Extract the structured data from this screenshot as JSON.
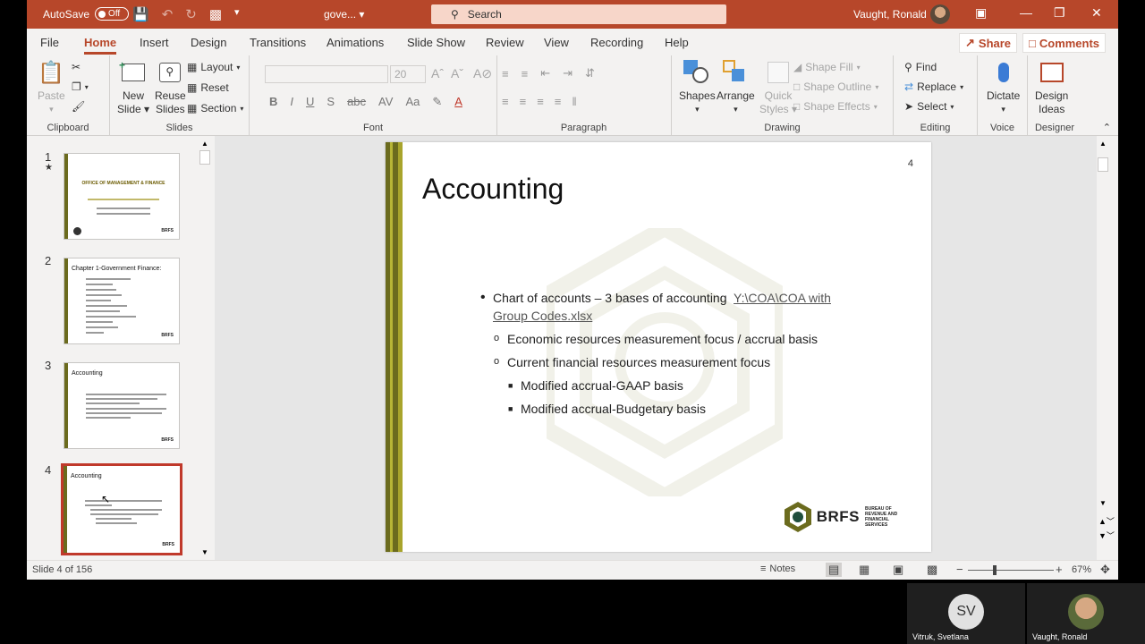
{
  "titlebar": {
    "autosave_label": "AutoSave",
    "autosave_state": "Off",
    "filename": "gove...",
    "search_placeholder": "Search",
    "user_name": "Vaught, Ronald"
  },
  "tabs": [
    {
      "label": "File"
    },
    {
      "label": "Home",
      "active": true
    },
    {
      "label": "Insert"
    },
    {
      "label": "Design"
    },
    {
      "label": "Transitions"
    },
    {
      "label": "Animations"
    },
    {
      "label": "Slide Show"
    },
    {
      "label": "Review"
    },
    {
      "label": "View"
    },
    {
      "label": "Recording"
    },
    {
      "label": "Help"
    }
  ],
  "share_label": "Share",
  "comments_label": "Comments",
  "ribbon": {
    "clipboard": {
      "label": "Clipboard",
      "paste": "Paste"
    },
    "slides": {
      "label": "Slides",
      "new_slide_1": "New",
      "new_slide_2": "Slide",
      "reuse_1": "Reuse",
      "reuse_2": "Slides",
      "layout": "Layout",
      "reset": "Reset",
      "section": "Section"
    },
    "font": {
      "label": "Font",
      "size": "20"
    },
    "paragraph": {
      "label": "Paragraph"
    },
    "drawing": {
      "label": "Drawing",
      "shapes": "Shapes",
      "arrange": "Arrange",
      "quick_1": "Quick",
      "quick_2": "Styles",
      "shape_fill": "Shape Fill",
      "shape_outline": "Shape Outline",
      "shape_effects": "Shape Effects"
    },
    "editing": {
      "label": "Editing",
      "find": "Find",
      "replace": "Replace",
      "select": "Select"
    },
    "voice": {
      "label": "Voice",
      "dictate": "Dictate"
    },
    "designer": {
      "label": "Designer",
      "ideas_1": "Design",
      "ideas_2": "Ideas"
    }
  },
  "thumbnails": [
    {
      "num": "1",
      "title": "OFFICE OF MANAGEMENT & FINANCE"
    },
    {
      "num": "2",
      "title": "Chapter 1-Government Finance:"
    },
    {
      "num": "3",
      "title": "Accounting"
    },
    {
      "num": "4",
      "title": "Accounting",
      "selected": true
    }
  ],
  "slide": {
    "number": "4",
    "title": "Accounting",
    "bullet1": "Chart of accounts – 3 bases of accounting",
    "bullet1_link_a": "Y:\\COA\\COA with",
    "bullet1_link_b": "Group Codes.xlsx",
    "sub1": "Economic resources measurement focus / accrual basis",
    "sub2": "Current financial resources measurement focus",
    "subsub1": "Modified accrual-GAAP basis",
    "subsub2": "Modified accrual-Budgetary basis",
    "logo": "BRFS",
    "logo_sub": "BUREAU OF REVENUE AND FINANCIAL SERVICES"
  },
  "status": {
    "slide_info": "Slide 4 of 156",
    "notes": "Notes",
    "zoom": "67%"
  },
  "participants": [
    {
      "initials": "SV",
      "name": "Vitruk, Svetlana"
    },
    {
      "initials": "",
      "name": "Vaught, Ronald"
    }
  ],
  "colors": {
    "accent": "#b7472a",
    "slide_bar": "#6b6b1e",
    "selected_thumb": "#c0392b"
  }
}
